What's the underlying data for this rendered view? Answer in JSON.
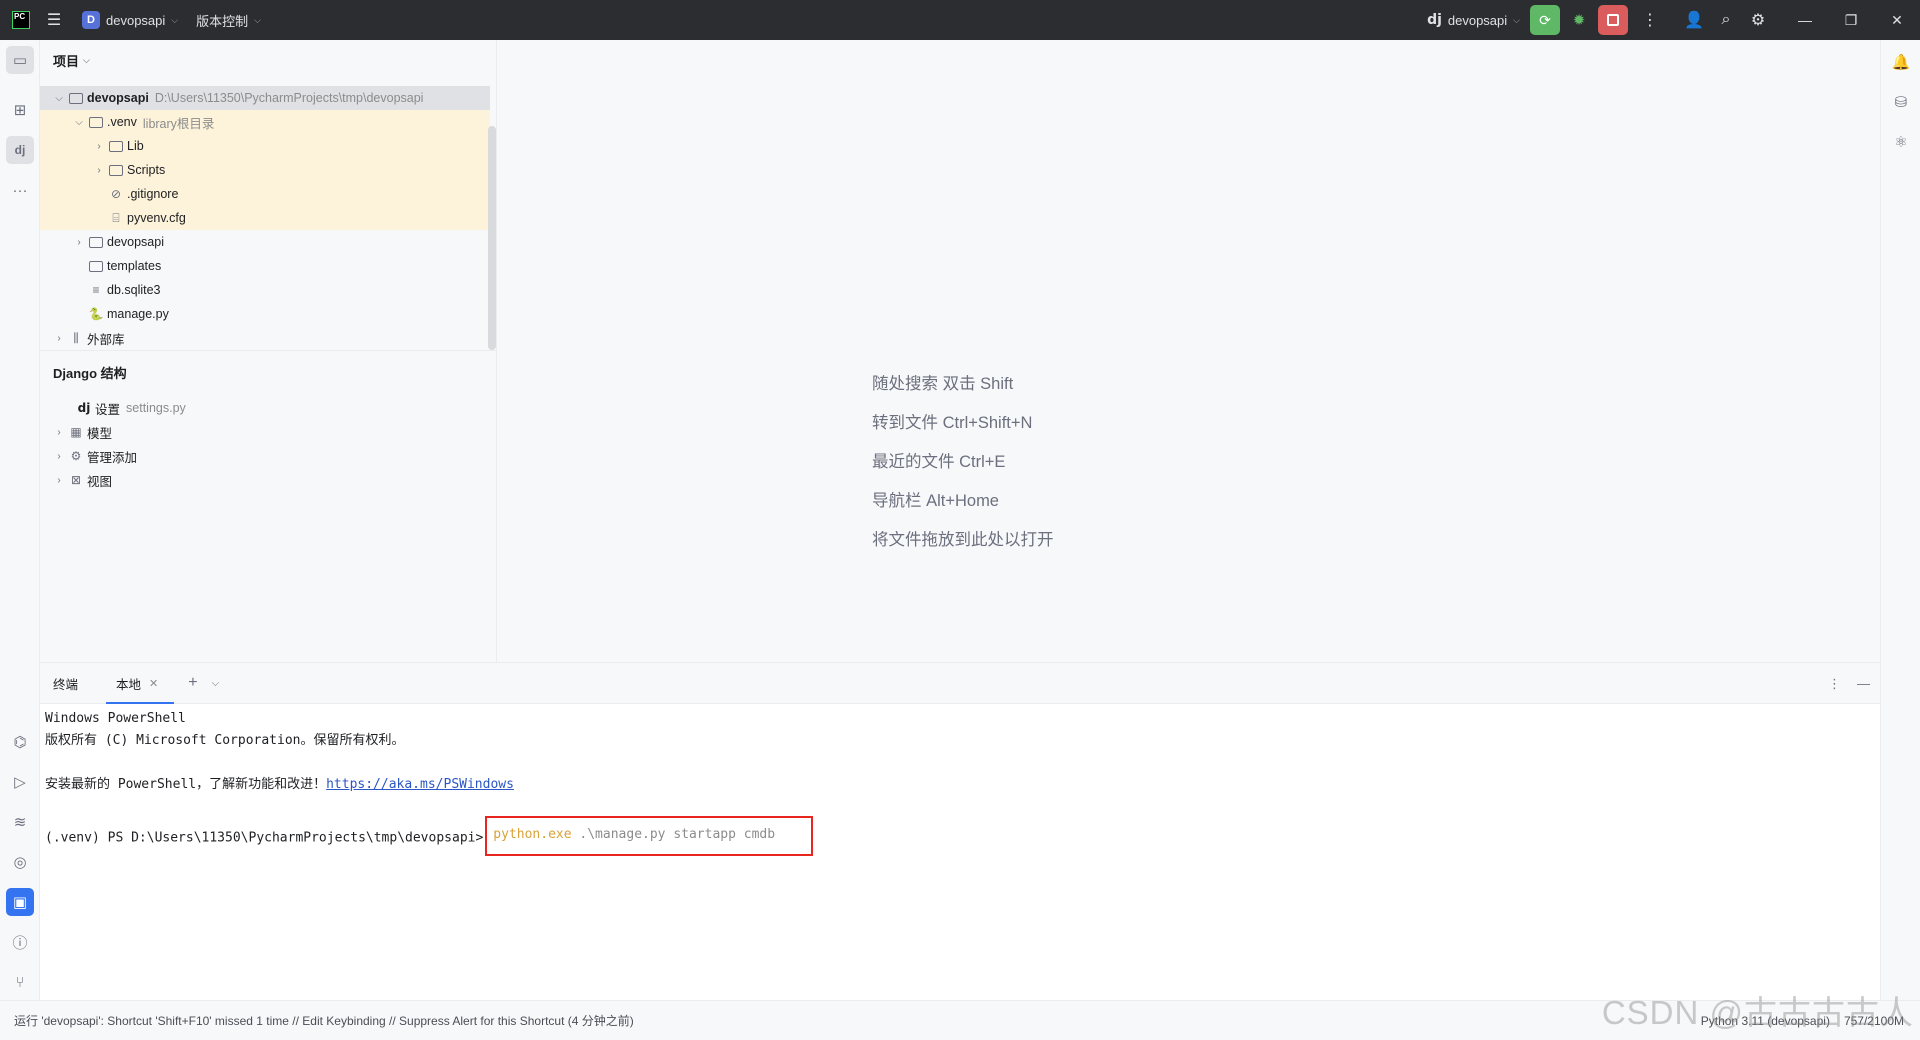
{
  "titlebar": {
    "app_logo": "PC",
    "project_badge": "D",
    "project_name": "devopsapi",
    "vcs_label": "版本控制",
    "run_config": "devopsapi",
    "run_config_logo": "dj",
    "colors": {
      "background": "#2b2d30",
      "run": "#5fb865",
      "stop": "#db5c5c",
      "accent": "#3574f0"
    }
  },
  "project_panel": {
    "header": "项目",
    "tree": [
      {
        "label": "devopsapi",
        "hint": "D:\\Users\\11350\\PycharmProjects\\tmp\\devopsapi",
        "icon": "folder-icon"
      },
      {
        "label": ".venv",
        "hint": "library根目录",
        "icon": "folder-icon"
      },
      {
        "label": "Lib",
        "hint": "",
        "icon": "folder-icon"
      },
      {
        "label": "Scripts",
        "hint": "",
        "icon": "folder-icon"
      },
      {
        "label": ".gitignore",
        "hint": "",
        "icon": "ignored-file-icon"
      },
      {
        "label": "pyvenv.cfg",
        "hint": "",
        "icon": "config-file-icon"
      },
      {
        "label": "devopsapi",
        "hint": "",
        "icon": "package-folder-icon"
      },
      {
        "label": "templates",
        "hint": "",
        "icon": "folder-icon"
      },
      {
        "label": "db.sqlite3",
        "hint": "",
        "icon": "text-file-icon"
      },
      {
        "label": "manage.py",
        "hint": "",
        "icon": "python-file-icon"
      },
      {
        "label": "外部库",
        "hint": "",
        "icon": "library-icon"
      }
    ]
  },
  "django_structure": {
    "header": "Django 结构",
    "items": [
      {
        "icon_text": "dj",
        "label": "设置",
        "hint": "settings.py"
      },
      {
        "icon_text": "",
        "label": "模型",
        "hint": ""
      },
      {
        "icon_text": "",
        "label": "管理添加",
        "hint": ""
      },
      {
        "icon_text": "",
        "label": "视图",
        "hint": ""
      }
    ]
  },
  "editor": {
    "hints": [
      "随处搜索 双击 Shift",
      "转到文件 Ctrl+Shift+N",
      "最近的文件 Ctrl+E",
      "导航栏 Alt+Home",
      "将文件拖放到此处以打开"
    ]
  },
  "terminal": {
    "tab_title": "终端",
    "session_tab": "本地",
    "lines": {
      "l1": "Windows PowerShell",
      "l2": "版权所有 (C) Microsoft Corporation。保留所有权利。",
      "l3_prefix": "安装最新的 PowerShell，了解新功能和改进！",
      "l3_link": "https://aka.ms/PSWindows",
      "prompt": "(.venv) PS D:\\Users\\11350\\PycharmProjects\\tmp\\devopsapi>",
      "cmd_exe": "python.exe",
      "cmd_args": " .\\manage.py startapp cmdb"
    }
  },
  "statusbar": {
    "message": "运行 'devopsapi': Shortcut 'Shift+F10' missed 1 time // Edit Keybinding // Suppress Alert for this Shortcut (4 分钟之前)",
    "interpreter": "Python 3.11 (devopsapi)",
    "memory": "757/2100M"
  },
  "watermark": "CSDN @古古古古人"
}
